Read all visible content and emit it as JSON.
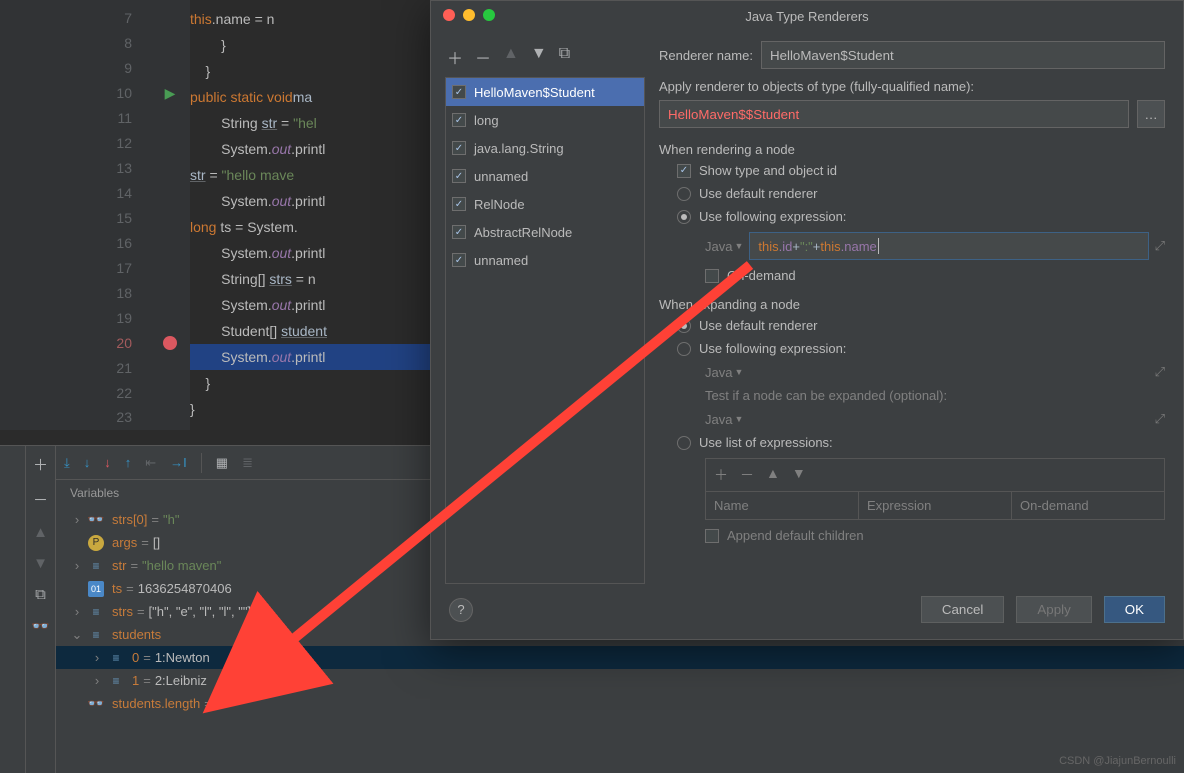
{
  "editor": {
    "lines": [
      {
        "n": 7,
        "html": "            <span class='kw'>this</span>.name = n"
      },
      {
        "n": 8,
        "html": "        }"
      },
      {
        "n": 9,
        "html": "    }"
      },
      {
        "n": 10,
        "icon": "play",
        "html": "    <span class='kw'>public static void</span> <span class='mth'>ma</span>"
      },
      {
        "n": 11,
        "html": "        String <span class='under ident'>str</span> = <span class='str'>\"hel</span>"
      },
      {
        "n": 12,
        "html": "        System.<span class='fld'>out</span>.printl"
      },
      {
        "n": 13,
        "html": "        <span class='under ident'>str</span> = <span class='str'>\"hello mave</span>"
      },
      {
        "n": 14,
        "html": "        System.<span class='fld'>out</span>.printl"
      },
      {
        "n": 15,
        "html": "        <span class='kw'>long</span> ts = System."
      },
      {
        "n": 16,
        "html": "        System.<span class='fld'>out</span>.printl"
      },
      {
        "n": 17,
        "html": "        String[] <span class='under ident'>strs</span> = n"
      },
      {
        "n": 18,
        "html": "        System.<span class='fld'>out</span>.printl"
      },
      {
        "n": 19,
        "html": "        Student[] <span class='under ident'>student</span>"
      },
      {
        "n": 20,
        "icon": "bp",
        "hl": true,
        "html": "        System.<span class='fld'>out</span>.printl"
      },
      {
        "n": 21,
        "html": "    }"
      },
      {
        "n": 22,
        "html": "}"
      },
      {
        "n": 23,
        "html": ""
      }
    ]
  },
  "dialog": {
    "title": "Java Type Renderers",
    "renderer_name_label": "Renderer name:",
    "renderer_name_value": "HelloMaven$Student",
    "apply_label": "Apply renderer to objects of type (fully-qualified name):",
    "apply_value": "HelloMaven$$Student",
    "list": [
      {
        "label": "HelloMaven$Student",
        "checked": true,
        "sel": true
      },
      {
        "label": "long",
        "checked": true
      },
      {
        "label": "java.lang.String",
        "checked": true
      },
      {
        "label": "unnamed",
        "checked": true
      },
      {
        "label": "RelNode",
        "checked": true
      },
      {
        "label": "AbstractRelNode",
        "checked": true
      },
      {
        "label": "unnamed",
        "checked": true
      }
    ],
    "rendering_section": "When rendering a node",
    "show_type_label": "Show type and object id",
    "use_default_label": "Use default renderer",
    "use_expr_label": "Use following expression:",
    "java_label": "Java",
    "expr_parts": {
      "p1": "this",
      "p2": ".id",
      "p3": " + ",
      "p4": "\":\"",
      "p5": " +",
      "p6": "this",
      "p7": ".name"
    },
    "on_demand_label": "On-demand",
    "expanding_section": "When expanding a node",
    "use_default2": "Use default renderer",
    "use_expr2": "Use following expression:",
    "test_label": "Test if a node can be expanded (optional):",
    "use_list_label": "Use list of expressions:",
    "table_headers": {
      "name": "Name",
      "expr": "Expression",
      "ondemand": "On-demand"
    },
    "append_label": "Append default children",
    "cancel": "Cancel",
    "apply": "Apply",
    "ok": "OK"
  },
  "debug": {
    "vars_title": "Variables",
    "rows": [
      {
        "indent": 0,
        "exp": ">",
        "icon": "glasses",
        "name": "strs[0]",
        "val": "\"h\"",
        "valcls": "vval-str"
      },
      {
        "indent": 0,
        "exp": "",
        "icon": "p",
        "name": "args",
        "val": "[]"
      },
      {
        "indent": 0,
        "exp": ">",
        "icon": "bars",
        "name": "str",
        "val": "\"hello maven\"",
        "valcls": "vval-str"
      },
      {
        "indent": 0,
        "exp": "",
        "icon": "01",
        "name": "ts",
        "val": "1636254870406"
      },
      {
        "indent": 0,
        "exp": ">",
        "icon": "bars",
        "name": "strs",
        "val": "[\"h\", \"e\", \"l\", \"l\", \"\"]"
      },
      {
        "indent": 0,
        "exp": "v",
        "icon": "bars",
        "name": "students",
        "val": ""
      },
      {
        "indent": 1,
        "exp": ">",
        "icon": "bars",
        "name": "0",
        "val": "1:Newton",
        "sel": true
      },
      {
        "indent": 1,
        "exp": ">",
        "icon": "bars",
        "name": "1",
        "val": "2:Leibniz"
      },
      {
        "indent": 0,
        "exp": "",
        "icon": "glasses",
        "name": "students.length",
        "val": "2"
      }
    ]
  },
  "watermark": "CSDN @JiajunBernoulli"
}
